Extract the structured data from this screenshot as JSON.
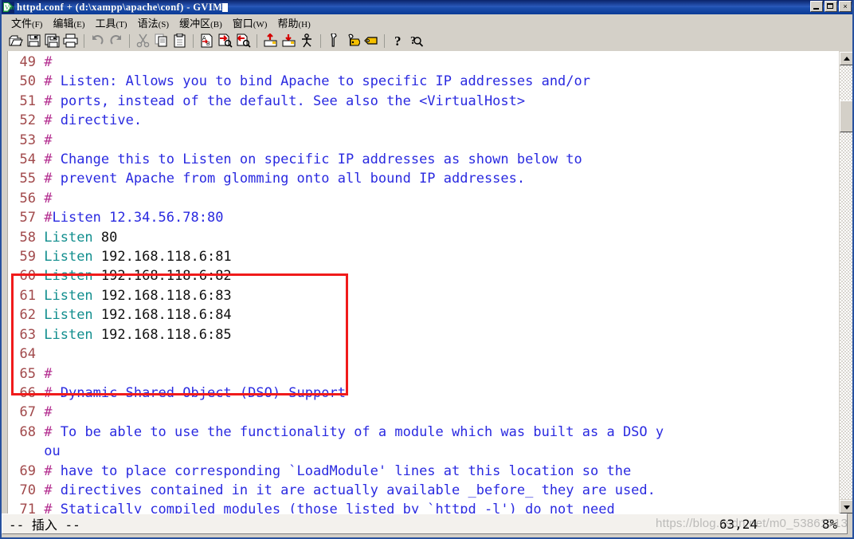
{
  "window": {
    "title": "httpd.conf + (d:\\xampp\\apache\\conf) - GVIM",
    "icon": "gvim-icon",
    "buttons": {
      "minimize": "minimize-icon",
      "maximize": "maximize-icon",
      "close": "×"
    }
  },
  "menu": {
    "items": [
      {
        "name": "文件",
        "key": "(F)"
      },
      {
        "name": "编辑",
        "key": "(E)"
      },
      {
        "name": "工具",
        "key": "(T)"
      },
      {
        "name": "语法",
        "key": "(S)"
      },
      {
        "name": "缓冲区",
        "key": "(B)"
      },
      {
        "name": "窗口",
        "key": "(W)"
      },
      {
        "name": "帮助",
        "key": "(H)"
      }
    ]
  },
  "toolbar": {
    "buttons": [
      "open-file-icon",
      "save-icon",
      "save-all-icon",
      "print-icon",
      "undo-icon",
      "redo-icon",
      "cut-icon",
      "copy-icon",
      "paste-icon",
      "find-replace-icon",
      "find-next-icon",
      "find-prev-icon",
      "load-session-icon",
      "save-session-icon",
      "run-script-icon",
      "make-icon",
      "build-tags-icon",
      "jump-tag-icon",
      "help-icon",
      "find-help-icon"
    ]
  },
  "editor": {
    "lines": [
      {
        "num": "49",
        "segments": [
          {
            "t": "#",
            "c": "hash"
          }
        ]
      },
      {
        "num": "50",
        "segments": [
          {
            "t": "#",
            "c": "hash"
          },
          {
            "t": " Listen: Allows you to bind Apache to specific IP addresses and/or",
            "c": "cmt"
          }
        ]
      },
      {
        "num": "51",
        "segments": [
          {
            "t": "#",
            "c": "hash"
          },
          {
            "t": " ports, instead of the default. See also the <VirtualHost>",
            "c": "cmt"
          }
        ]
      },
      {
        "num": "52",
        "segments": [
          {
            "t": "#",
            "c": "hash"
          },
          {
            "t": " directive.",
            "c": "cmt"
          }
        ]
      },
      {
        "num": "53",
        "segments": [
          {
            "t": "#",
            "c": "hash"
          }
        ]
      },
      {
        "num": "54",
        "segments": [
          {
            "t": "#",
            "c": "hash"
          },
          {
            "t": " Change this to Listen on specific IP addresses as shown below to",
            "c": "cmt"
          }
        ]
      },
      {
        "num": "55",
        "segments": [
          {
            "t": "#",
            "c": "hash"
          },
          {
            "t": " prevent Apache from glomming onto all bound IP addresses.",
            "c": "cmt"
          }
        ]
      },
      {
        "num": "56",
        "segments": [
          {
            "t": "#",
            "c": "hash"
          }
        ]
      },
      {
        "num": "57",
        "segments": [
          {
            "t": "#",
            "c": "hash"
          },
          {
            "t": "Listen 12.34.56.78:80",
            "c": "cmt"
          }
        ]
      },
      {
        "num": "58",
        "segments": [
          {
            "t": "Listen",
            "c": "kw"
          },
          {
            "t": " 80",
            "c": "val"
          }
        ]
      },
      {
        "num": "59",
        "segments": [
          {
            "t": "Listen",
            "c": "kw"
          },
          {
            "t": " 192.168.118.6:81",
            "c": "val"
          }
        ]
      },
      {
        "num": "60",
        "segments": [
          {
            "t": "Listen",
            "c": "kw"
          },
          {
            "t": " 192.168.118.6:82",
            "c": "val"
          }
        ]
      },
      {
        "num": "61",
        "segments": [
          {
            "t": "Listen",
            "c": "kw"
          },
          {
            "t": " 192.168.118.6:83",
            "c": "val"
          }
        ]
      },
      {
        "num": "62",
        "segments": [
          {
            "t": "Listen",
            "c": "kw"
          },
          {
            "t": " 192.168.118.6:84",
            "c": "val"
          }
        ]
      },
      {
        "num": "63",
        "segments": [
          {
            "t": "Listen",
            "c": "kw"
          },
          {
            "t": " 192.168.118.6:85",
            "c": "val"
          }
        ]
      },
      {
        "num": "64",
        "segments": []
      },
      {
        "num": "65",
        "segments": [
          {
            "t": "#",
            "c": "hash"
          }
        ]
      },
      {
        "num": "66",
        "segments": [
          {
            "t": "#",
            "c": "hash"
          },
          {
            "t": " Dynamic Shared Object (DSO) Support",
            "c": "cmt"
          }
        ]
      },
      {
        "num": "67",
        "segments": [
          {
            "t": "#",
            "c": "hash"
          }
        ]
      },
      {
        "num": "68",
        "segments": [
          {
            "t": "#",
            "c": "hash"
          },
          {
            "t": " To be able to use the functionality of a module which was built as a DSO y",
            "c": "cmt"
          }
        ],
        "wrap": "ou"
      },
      {
        "num": "69",
        "segments": [
          {
            "t": "#",
            "c": "hash"
          },
          {
            "t": " have to place corresponding `LoadModule' lines at this location so the",
            "c": "cmt"
          }
        ]
      },
      {
        "num": "70",
        "segments": [
          {
            "t": "#",
            "c": "hash"
          },
          {
            "t": " directives contained in it are actually available _before_ they are used.",
            "c": "cmt"
          }
        ]
      },
      {
        "num": "71",
        "segments": [
          {
            "t": "#",
            "c": "hash"
          },
          {
            "t": " Statically compiled modules (those listed by `httpd -l') do not need",
            "c": "cmt"
          }
        ]
      }
    ],
    "annotation": {
      "name": "red-highlight-box",
      "color": "#f01b1b"
    }
  },
  "statusbar": {
    "mode": "-- 插入 --",
    "position": "63,24",
    "percent": "8%"
  },
  "watermark": {
    "text": "https://blog.csdn.net/m0_53861713"
  },
  "colors": {
    "titlebar": "#0a246a",
    "chrome": "#d4d0c8",
    "line_number": "#a1494b",
    "comment": "#2a2ae0",
    "hash": "#b32d8f",
    "keyword": "#118e8e",
    "value": "#111111",
    "annotation": "#f01b1b"
  }
}
